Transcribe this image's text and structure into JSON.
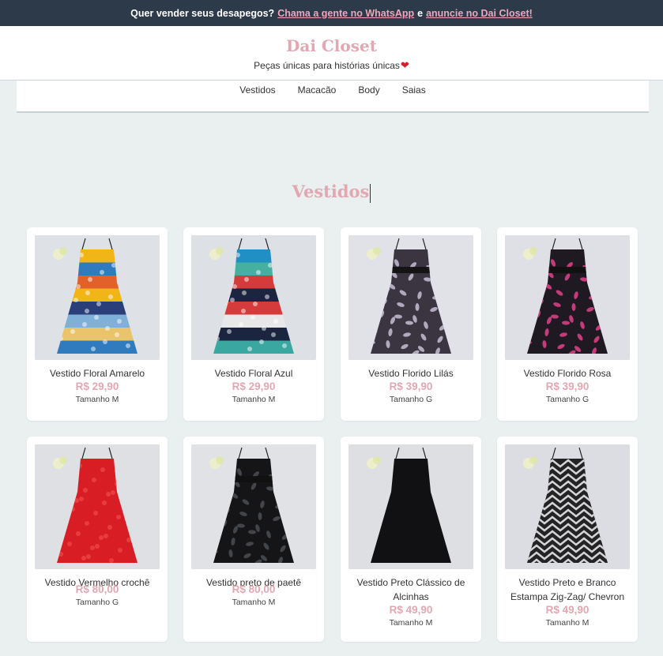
{
  "announcement": {
    "text": "Quer vender seus desapegos?",
    "link1": "Chama a gente no WhatsApp",
    "joiner": "e",
    "link2": "anuncie no Dai Closet!"
  },
  "header": {
    "brand": "Dai Closet",
    "tagline": "Peças únicas para histórias únicas",
    "tagline_emoji": "❤"
  },
  "nav": [
    {
      "label": "Vestidos"
    },
    {
      "label": "Macacão"
    },
    {
      "label": "Body"
    },
    {
      "label": "Saias"
    }
  ],
  "section_title": "Vestidos",
  "products": [
    {
      "name": "Vestido Floral Amarelo",
      "price": "R$ 29,90",
      "size": "Tamanho M",
      "icon": "yellow-floral-dress"
    },
    {
      "name": "Vestido Floral Azul",
      "price": "R$ 29,90",
      "size": "Tamanho M",
      "icon": "blue-floral-dress"
    },
    {
      "name": "Vestido Florido Lilás",
      "price": "R$ 39,90",
      "size": "Tamanho G",
      "icon": "lilac-floral-dress"
    },
    {
      "name": "Vestido Florido Rosa",
      "price": "R$ 39,90",
      "size": "Tamanho G",
      "icon": "pink-floral-dress"
    },
    {
      "name": "Vestido Vermelho crochê",
      "price": "R$ 80,00",
      "size": "Tamanho G",
      "icon": "red-crochet-dress"
    },
    {
      "name": "Vestido preto de paetê",
      "price": "R$ 80,00",
      "size": "Tamanho M",
      "icon": "black-sequin-dress"
    },
    {
      "name": "Vestido Preto Clássico de Alcinhas",
      "price": "R$ 49,90",
      "size": "Tamanho M",
      "icon": "black-strap-dress"
    },
    {
      "name": "Vestido Preto e Branco Estampa Zig-Zag/ Chevron",
      "price": "R$ 49,90",
      "size": "Tamanho M",
      "icon": "chevron-dress"
    }
  ],
  "colors": {
    "topbar_bg": "#2d3a4a",
    "accent_pink": "#e3a7b1",
    "link_pink": "#f0a6b6",
    "page_bg": "#eaeff0"
  }
}
